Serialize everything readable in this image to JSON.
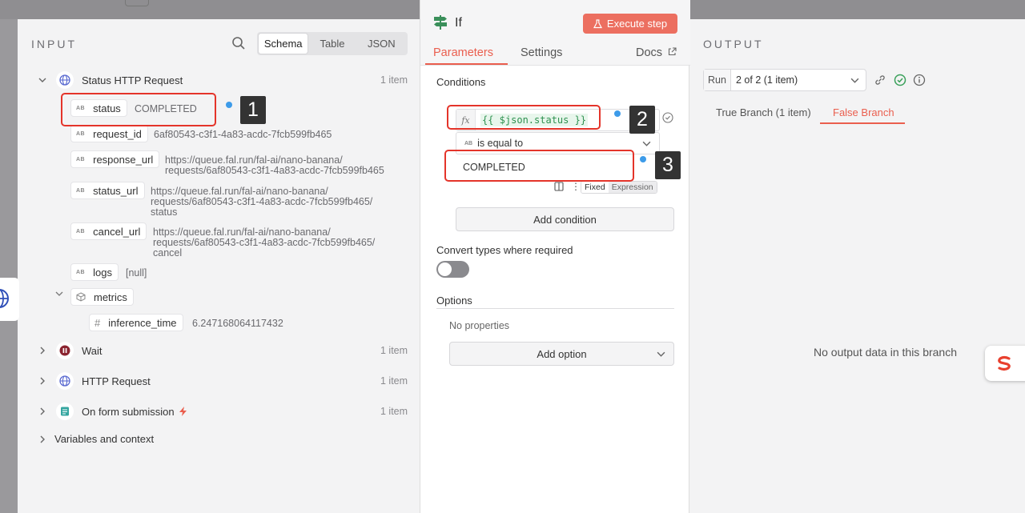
{
  "input": {
    "title": "INPUT",
    "view_tabs": [
      "Schema",
      "Table",
      "JSON"
    ],
    "root_node": {
      "label": "Status HTTP Request",
      "count": "1 item"
    },
    "fields": [
      {
        "key": "status",
        "value": "COMPLETED"
      },
      {
        "key": "request_id",
        "value": "6af80543-c3f1-4a83-acdc-7fcb599fb465"
      },
      {
        "key": "response_url",
        "value_lines": [
          "https://queue.fal.run/fal-ai/nano-banana/",
          "requests/6af80543-c3f1-4a83-acdc-7fcb599fb465"
        ]
      },
      {
        "key": "status_url",
        "value_lines": [
          "https://queue.fal.run/fal-ai/nano-banana/",
          "requests/6af80543-c3f1-4a83-acdc-7fcb599fb465/",
          "status"
        ]
      },
      {
        "key": "cancel_url",
        "value_lines": [
          "https://queue.fal.run/fal-ai/nano-banana/",
          "requests/6af80543-c3f1-4a83-acdc-7fcb599fb465/",
          "cancel"
        ]
      },
      {
        "key": "logs",
        "value": "[null]"
      }
    ],
    "metrics": {
      "label": "metrics",
      "child_key": "inference_time",
      "child_value": "6.247168064117432"
    },
    "other_nodes": [
      {
        "label": "Wait",
        "count": "1 item"
      },
      {
        "label": "HTTP Request",
        "count": "1 item"
      },
      {
        "label": "On form submission",
        "count": "1 item"
      }
    ],
    "variables_label": "Variables and context"
  },
  "node": {
    "title": "If",
    "execute_label": "Execute step",
    "tabs": {
      "parameters": "Parameters",
      "settings": "Settings",
      "docs": "Docs"
    },
    "conditions_label": "Conditions",
    "left_value": "{{ $json.status }}",
    "operator": "is equal to",
    "right_value": "COMPLETED",
    "mode_fixed": "Fixed",
    "mode_expression": "Expression",
    "add_condition_label": "Add condition",
    "convert_types_label": "Convert types where required",
    "options_label": "Options",
    "no_properties": "No properties",
    "add_option_label": "Add option"
  },
  "output": {
    "title": "OUTPUT",
    "run_label": "Run",
    "run_value": "2 of 2 (1 item)",
    "true_branch": "True Branch (1 item)",
    "false_branch": "False Branch",
    "empty_message": "No output data in this branch"
  },
  "annotations": [
    "1",
    "2",
    "3"
  ],
  "colors": {
    "accent": "#ea5e4e",
    "execute": "#ec6f60",
    "annotation": "#e4342a",
    "dot": "#3d9be9"
  }
}
